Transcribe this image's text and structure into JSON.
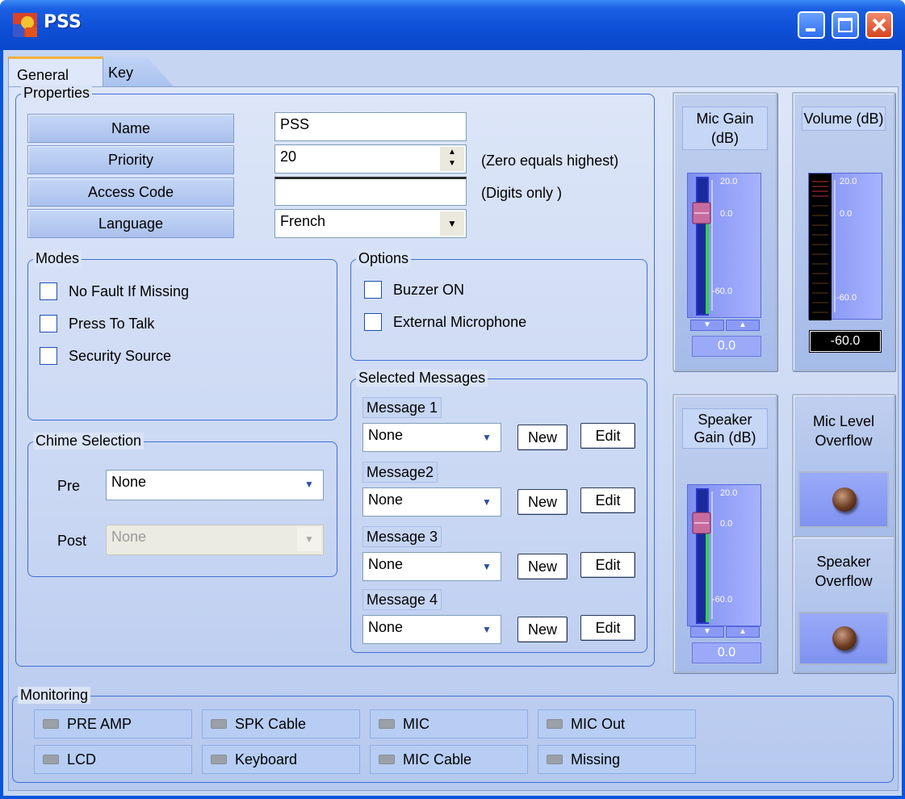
{
  "window": {
    "title": "PSS"
  },
  "tabs": [
    "General",
    "Key"
  ],
  "properties": {
    "title": "Properties",
    "labels": [
      "Name",
      "Priority",
      "Access Code",
      "Language"
    ],
    "name_value": "PSS",
    "priority_value": "20",
    "priority_hint": "(Zero equals highest)",
    "access_code_value": "",
    "access_code_hint": "(Digits only )",
    "language_value": "French"
  },
  "modes": {
    "title": "Modes",
    "items": [
      "No Fault If Missing",
      "Press To Talk",
      "Security Source"
    ]
  },
  "options": {
    "title": "Options",
    "items": [
      "Buzzer ON",
      "External Microphone"
    ]
  },
  "chime": {
    "title": "Chime Selection",
    "pre_label": "Pre",
    "pre_value": "None",
    "post_label": "Post",
    "post_value": "None"
  },
  "messages": {
    "title": "Selected Messages",
    "items": [
      {
        "label": "Message 1",
        "value": "None"
      },
      {
        "label": "Message2",
        "value": "None"
      },
      {
        "label": "Message 3",
        "value": "None"
      },
      {
        "label": "Message 4",
        "value": "None"
      }
    ],
    "new_label": "New",
    "edit_label": "Edit"
  },
  "meters": {
    "mic_gain": {
      "title": "Mic Gain (dB)",
      "top": "20.0",
      "mid": "0.0",
      "bottom": "-60.0",
      "value": "0.0"
    },
    "volume": {
      "title": "Volume (dB)",
      "top": "20.0",
      "mid": "0.0",
      "bottom": "-60.0",
      "value": "-60.0"
    },
    "speaker_gain": {
      "title": "Speaker Gain (dB)",
      "top": "20.0",
      "mid": "0.0",
      "bottom": "-60.0",
      "value": "0.0"
    },
    "mic_level_overflow": "Mic Level Overflow",
    "speaker_overflow": "Speaker Overflow"
  },
  "monitoring": {
    "title": "Monitoring",
    "items": [
      "PRE AMP",
      "SPK Cable",
      "MIC",
      "MIC Out",
      "LCD",
      "Keyboard",
      "MIC Cable",
      "Missing"
    ]
  },
  "colors": {
    "accent": "#3f6fd6",
    "title_bar": "#0d4fd6",
    "tab_highlight": "#f3b23a"
  }
}
